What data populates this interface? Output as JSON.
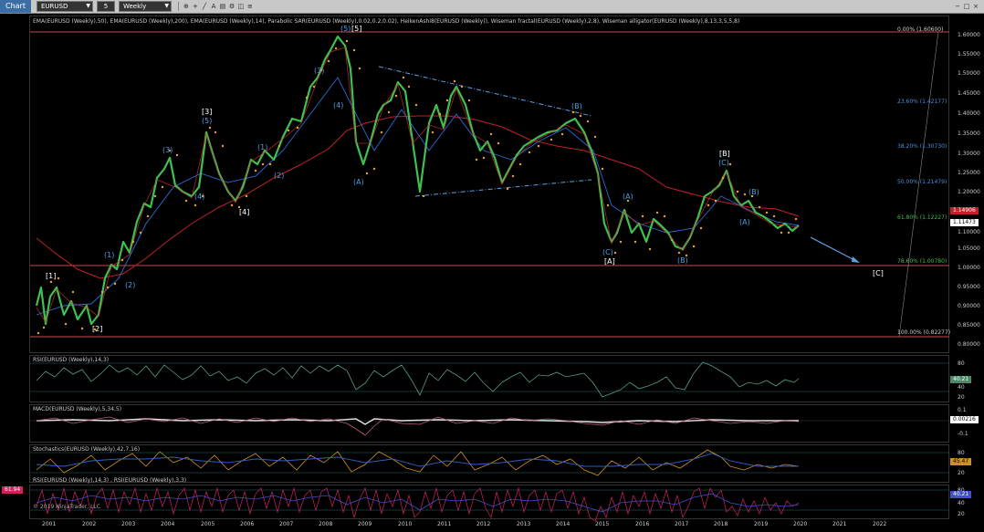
{
  "toolbar": {
    "title": "Chart",
    "symbol": "EURUSD",
    "interval": "5",
    "period": "Weekly",
    "icons": [
      "zoom-icon",
      "crosshair-icon",
      "draw-icon",
      "text-icon",
      "template-icon",
      "properties-icon",
      "split-icon",
      "more-icon"
    ]
  },
  "main": {
    "indicators_label": "EMA(EURUSD (Weekly),50), EMA(EURUSD (Weekly),200), EMA(EURUSD (Weekly),14), Parabolic SAR(EURUSD (Weekly),0.02,0.2,0.02), HeikenAshi8(EURUSD (Weekly)), Wiseman fractal(EURUSD (Weekly),2,8), Wiseman alligator(EURUSD (Weekly),8,13,3,5,5,8)",
    "price_axis": [
      "1.60000",
      "1.55000",
      "1.50000",
      "1.45000",
      "1.40000",
      "1.35000",
      "1.30000",
      "1.25000",
      "1.20000",
      "1.15000",
      "1.10000",
      "1.05000",
      "1.00000",
      "0.95000",
      "0.90000",
      "0.85000",
      "0.80000"
    ],
    "price_tags": {
      "red": "1.14906",
      "current": "1.11473"
    },
    "fib_levels": [
      "0.00% (1.60600)",
      "23.60% (1.42177)",
      "38.20% (1.30730)",
      "50.00% (1.21479)",
      "61.80% (1.12227)",
      "78.60% (1.00780)",
      "100.00% (0.82277)"
    ],
    "waves_primary": [
      "[1]",
      "[2]",
      "[3]",
      "[4]",
      "[5]",
      "[A]",
      "[B]",
      "[C]"
    ],
    "waves_inner": [
      "(1)",
      "(2)",
      "(3)",
      "(4)",
      "(5)",
      "(A)",
      "(B)",
      "(C)"
    ],
    "colors": {
      "fib_line": "#c84a4a",
      "sma_red": "#c0202a",
      "ema_blue": "#2a6ad8",
      "sar": "#f0a020",
      "heiken_green": "#40c050",
      "heiken_red": "#d03030",
      "wave_blue": "#4aa0e0",
      "arrow_blue": "#5aa0e8",
      "rsi_line": "#5a9a8a",
      "macd": "#c06080",
      "stoch_k": "#d09020",
      "stoch_d": "#3060c0",
      "rsi2_red": "#d02060",
      "rsi2_blue": "#4050d0"
    }
  },
  "rsi": {
    "label": "RSI(EURUSD (Weekly),14,3)",
    "axis": [
      "80",
      "40",
      "20"
    ],
    "value": "40.21"
  },
  "macd": {
    "label": "MACD(EURUSD (Weekly),5,34,5)",
    "axis": [
      "0.1",
      "0",
      "-0.1"
    ],
    "value": "0.00216"
  },
  "stoch": {
    "label": "Stochastics(EURUSD (Weekly),42,7,16)",
    "axis": [
      "80",
      "20"
    ],
    "value": "45.47"
  },
  "rsi2": {
    "label": "RSI(EURUSD (Weekly),14,3) , RSI(EURUSD (Weekly),3,3)",
    "axis": [
      "80",
      "40",
      "20"
    ],
    "value": "40.21",
    "left_tag": "61.94"
  },
  "copyright": "© 2019 NinjaTrader, LLC",
  "years": [
    "2001",
    "2002",
    "2003",
    "2004",
    "2005",
    "2006",
    "2007",
    "2008",
    "2009",
    "2010",
    "2011",
    "2012",
    "2013",
    "2014",
    "2015",
    "2016",
    "2017",
    "2018",
    "2019",
    "2020",
    "2021",
    "2022"
  ]
}
